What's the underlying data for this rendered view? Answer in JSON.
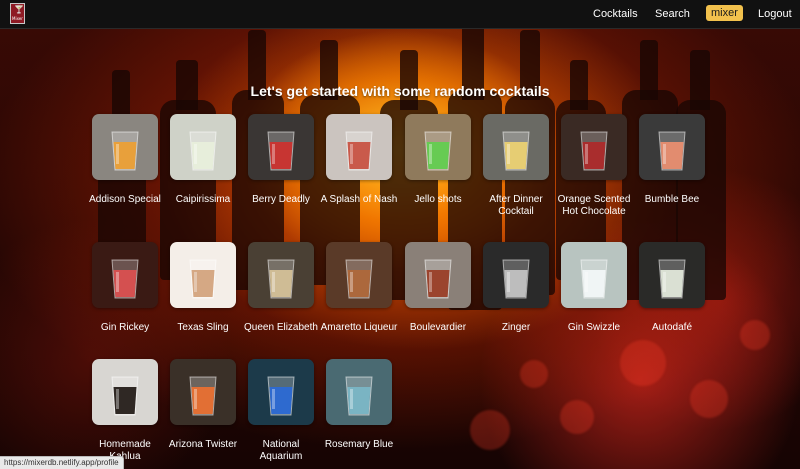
{
  "app": {
    "logo_caption": "Mixer",
    "logo_glyph": "🍸"
  },
  "nav": {
    "items": [
      {
        "label": "Cocktails",
        "name": "nav-cocktails"
      },
      {
        "label": "Search",
        "name": "nav-search"
      },
      {
        "label": "mixer",
        "name": "nav-mixer"
      },
      {
        "label": "Logout",
        "name": "nav-logout"
      }
    ]
  },
  "main": {
    "heading": "Let's get started with some random cocktails"
  },
  "cocktails": [
    {
      "name": "Addison Special",
      "bg": "#8a8680",
      "drink": "#f0a030"
    },
    {
      "name": "Caipirissima",
      "bg": "#cfd2c8",
      "drink": "#e8f0dc"
    },
    {
      "name": "Berry Deadly",
      "bg": "#3a3634",
      "drink": "#d2302c"
    },
    {
      "name": "A Splash of Nash",
      "bg": "#cbc4bf",
      "drink": "#c84c3c"
    },
    {
      "name": "Jello shots",
      "bg": "#8f7a5c",
      "drink": "#5fd04e"
    },
    {
      "name": "After Dinner Cocktail",
      "bg": "#6a6a64",
      "drink": "#f0d470"
    },
    {
      "name": "Orange Scented Hot Chocolate",
      "bg": "#3a2a24",
      "drink": "#b02828"
    },
    {
      "name": "Bumble Bee",
      "bg": "#3a3a3a",
      "drink": "#f09070"
    },
    {
      "name": "Gin Rickey",
      "bg": "#3a1a14",
      "drink": "#e05050"
    },
    {
      "name": "Texas Sling",
      "bg": "#f4eee8",
      "drink": "#d0a078"
    },
    {
      "name": "Queen Elizabeth",
      "bg": "#4a4034",
      "drink": "#d8c49a"
    },
    {
      "name": "Amaretto Liqueur",
      "bg": "#5a3a28",
      "drink": "#b06838"
    },
    {
      "name": "Boulevardier",
      "bg": "#8a8078",
      "drink": "#9a3a22"
    },
    {
      "name": "Zinger",
      "bg": "#2a2a2a",
      "drink": "#c8c8c8"
    },
    {
      "name": "Gin Swizzle",
      "bg": "#b8c4c0",
      "drink": "#f4f8f8"
    },
    {
      "name": "Autodafé",
      "bg": "#2a2a28",
      "drink": "#e8eee0"
    },
    {
      "name": "Homemade Kahlua",
      "bg": "#d8d6d2",
      "drink": "#1c1410"
    },
    {
      "name": "Arizona Twister",
      "bg": "#3a3028",
      "drink": "#f07030"
    },
    {
      "name": "National Aquarium",
      "bg": "#1c3a4a",
      "drink": "#2a6ad8"
    },
    {
      "name": "Rosemary Blue",
      "bg": "#4a6a72",
      "drink": "#7ab8c8"
    }
  ],
  "status_url": "https://mixerdb.netlify.app/profile"
}
